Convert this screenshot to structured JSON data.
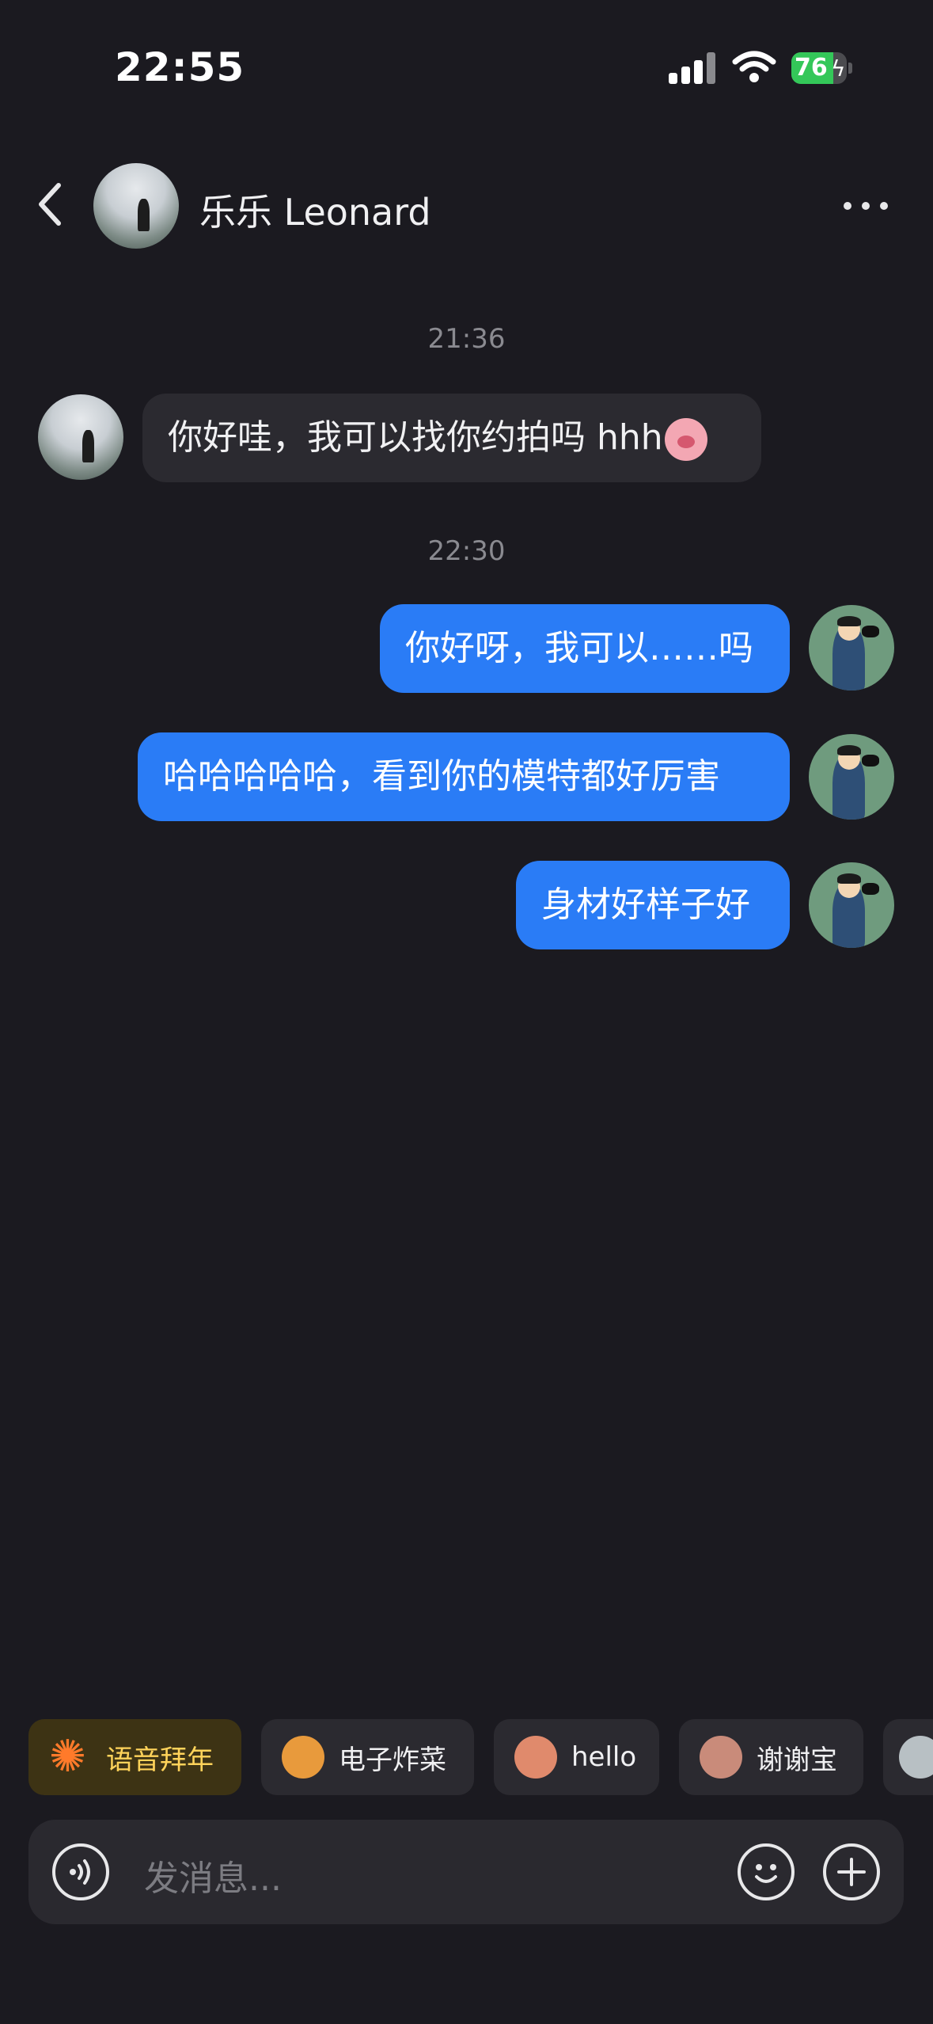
{
  "status_bar": {
    "time": "22:55",
    "battery": "76",
    "battery_level": 0.76
  },
  "header": {
    "contact_name": "乐乐 Leonard"
  },
  "messages": [
    {
      "timestamp": "21:36"
    },
    {
      "direction": "incoming",
      "text": "你好哇，我可以找你约拍吗 hhh"
    },
    {
      "timestamp": "22:30"
    },
    {
      "direction": "outgoing",
      "text": "你好呀，我可以……吗"
    },
    {
      "direction": "outgoing",
      "text": "哈哈哈哈哈，看到你的模特都好厉害"
    },
    {
      "direction": "outgoing",
      "text": "身材好样子好"
    }
  ],
  "quick_replies": [
    {
      "label": "语音拜年",
      "icon": "firework-icon"
    },
    {
      "label": "电子炸菜",
      "icon": "hotpot-icon"
    },
    {
      "label": "hello",
      "icon": "face-emoji-icon"
    },
    {
      "label": "谢谢宝",
      "icon": "thanks-emoji-icon"
    }
  ],
  "composer": {
    "placeholder": "发消息..."
  },
  "colors": {
    "background": "#1b1a20",
    "outgoing_bubble": "#2a7cf6",
    "incoming_bubble": "#2b2a30"
  }
}
